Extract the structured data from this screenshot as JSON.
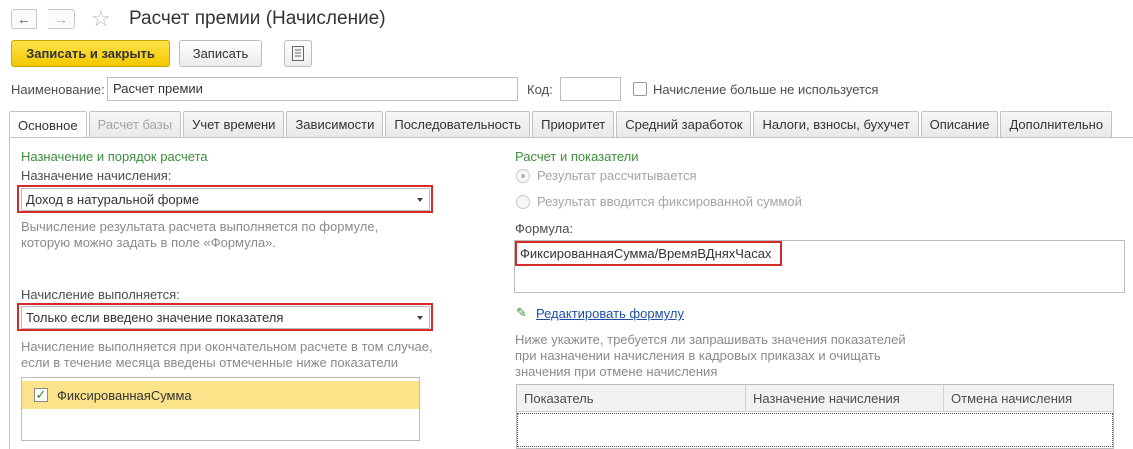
{
  "window": {
    "title": "Расчет премии (Начисление)",
    "back_glyph": "←",
    "forward_glyph": "→",
    "favorite_glyph": "☆"
  },
  "toolbar": {
    "save_close_label": "Записать и закрыть",
    "save_label": "Записать",
    "more_icon": "document-list-icon"
  },
  "header": {
    "name_label": "Наименование:",
    "name_value": "Расчет премии",
    "code_label": "Код:",
    "code_value": "",
    "not_used_label": "Начисление больше не используется"
  },
  "tabs": [
    {
      "label": "Основное",
      "state": "active"
    },
    {
      "label": "Расчет базы",
      "state": "disabled"
    },
    {
      "label": "Учет времени",
      "state": "normal"
    },
    {
      "label": "Зависимости",
      "state": "normal"
    },
    {
      "label": "Последовательность",
      "state": "normal"
    },
    {
      "label": "Приоритет",
      "state": "normal"
    },
    {
      "label": "Средний заработок",
      "state": "normal"
    },
    {
      "label": "Налоги, взносы, бухучет",
      "state": "normal"
    },
    {
      "label": "Описание",
      "state": "normal"
    },
    {
      "label": "Дополнительно",
      "state": "normal"
    }
  ],
  "left": {
    "section_title": "Назначение и порядок расчета",
    "purpose_label": "Назначение начисления:",
    "purpose_value": "Доход в натуральной форме",
    "purpose_hint_1": "Вычисление результата расчета выполняется по формуле,",
    "purpose_hint_2": "которую можно задать в поле «Формула».",
    "executed_label": "Начисление выполняется:",
    "executed_value": "Только если введено значение показателя",
    "executed_hint_1": "Начисление выполняется при окончательном расчете в том случае,",
    "executed_hint_2": "если в течение месяца введены отмеченные ниже показатели",
    "indicators": [
      {
        "label": "ФиксированнаяСумма",
        "checked": true
      }
    ]
  },
  "right": {
    "section_title": "Расчет и показатели",
    "radio_calculated": "Результат рассчитывается",
    "radio_fixed": "Результат вводится фиксированной суммой",
    "formula_label": "Формула:",
    "formula_value": "ФиксированнаяСумма/ВремяВДняхЧасах",
    "edit_formula_link": "Редактировать формулу",
    "hint_1": "Ниже укажите, требуется ли запрашивать значения показателей",
    "hint_2": "при назначении начисления в кадровых приказах и очищать",
    "hint_3": "значения при отмене начисления",
    "table": {
      "columns": [
        "Показатель",
        "Назначение начисления",
        "Отмена начисления"
      ]
    }
  },
  "colors": {
    "accent_green": "#3c8d3c",
    "highlight_red": "#d62b2b",
    "primary_button": "#f4c800",
    "selected_row": "#fbe38a",
    "link_blue": "#1f4fa8"
  }
}
